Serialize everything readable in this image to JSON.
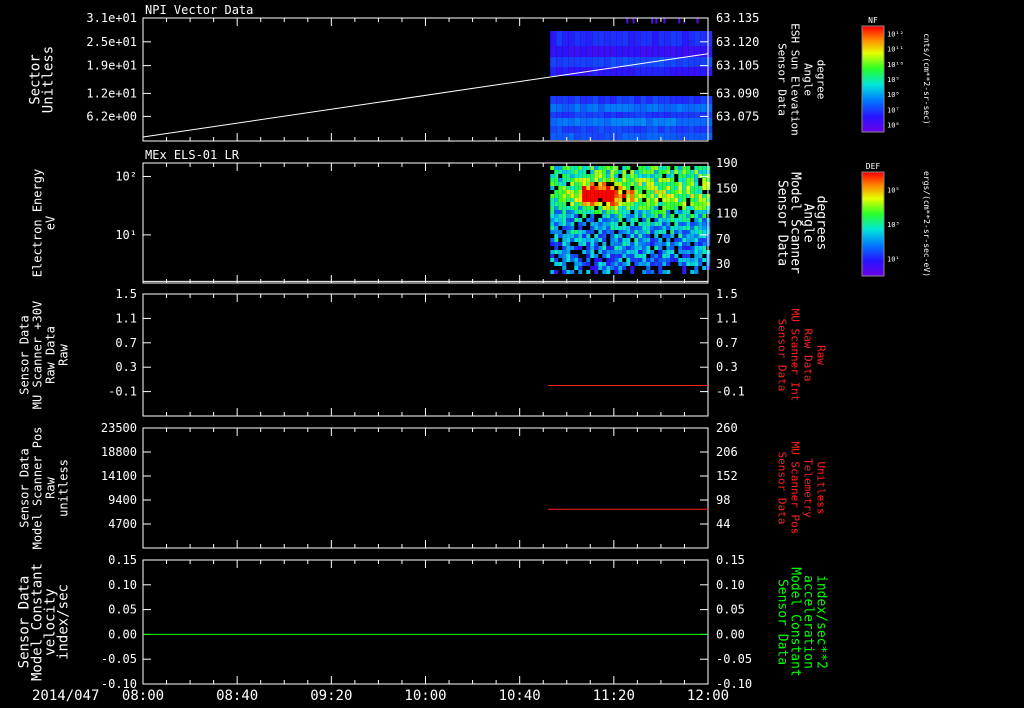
{
  "chart_data": {
    "type": "heatmap",
    "date_label": "2014/047",
    "x_ticks": [
      "08:00",
      "08:40",
      "09:20",
      "10:00",
      "10:40",
      "11:20",
      "12:00"
    ],
    "x_range": [
      "08:00",
      "12:00"
    ],
    "data_start": "10:53",
    "panels": [
      {
        "title": "NPI Vector Data",
        "left_label": [
          "Sector",
          "Unitless"
        ],
        "left_ticks": [
          "3.1e+01",
          "2.5e+01",
          "1.9e+01",
          "1.2e+01",
          "6.2e+00"
        ],
        "left_tick_values": [
          31,
          25,
          19,
          12,
          6.2
        ],
        "left_range": [
          0,
          31
        ],
        "right_label": [
          "Sensor Data",
          "ESH Sun Elevation",
          "Angle",
          "degree"
        ],
        "right_ticks": [
          "63.135",
          "63.120",
          "63.105",
          "63.090",
          "63.075"
        ],
        "line_color": "#ffffff",
        "line": {
          "x": [
            "08:00",
            "12:00"
          ],
          "y": [
            1.0,
            22.0
          ]
        },
        "colorbar": {
          "label": "NF",
          "unit": "cnts/(cm**2-sr-sec)",
          "ticks": [
            "10¹²",
            "10¹¹",
            "10¹⁰",
            "10⁹",
            "10⁸",
            "10⁷",
            "10⁶"
          ]
        }
      },
      {
        "title": "MEx ELS-01 LR",
        "left_label": [
          "Electron Energy",
          "eV"
        ],
        "left_ticks": [
          "10²",
          "10¹"
        ],
        "left_tick_values": [
          100,
          10
        ],
        "left_range": [
          1.5,
          170
        ],
        "right_label": [
          "Sensor Data",
          "Model Scanner",
          "Angle",
          "degrees"
        ],
        "right_ticks": [
          "190",
          "150",
          "110",
          "70",
          "30"
        ],
        "line_color": "#ffffff",
        "line": {
          "x": [
            "08:00",
            "12:00"
          ],
          "y": [
            1.6,
            1.6
          ]
        },
        "colorbar": {
          "label": "DEF",
          "unit": "ergs/(cm**2-sr-sec-eV)",
          "ticks": [
            "10⁵",
            "10³",
            "10¹"
          ]
        }
      },
      {
        "left_label": [
          "Sensor Data",
          "MU Scanner +30V",
          "Raw Data",
          "Raw"
        ],
        "left_ticks": [
          "1.5",
          "1.1",
          "0.7",
          "0.3",
          "-0.1"
        ],
        "left_tick_values": [
          1.5,
          1.1,
          0.7,
          0.3,
          -0.1
        ],
        "left_range": [
          -0.5,
          1.5
        ],
        "right_label": [
          "Sensor Data",
          "MU Scanner Int",
          "Raw Data",
          "Raw"
        ],
        "right_ticks": [
          "1.5",
          "1.1",
          "0.7",
          "0.3",
          "-0.1"
        ],
        "right_color": "#ff2020",
        "line_color": "#ff2020",
        "line": {
          "x": [
            "10:52",
            "12:00"
          ],
          "y": [
            0.0,
            0.0
          ]
        }
      },
      {
        "left_label": [
          "Sensor Data",
          "Model Scanner Pos",
          "Raw",
          "unitless"
        ],
        "left_ticks": [
          "23500",
          "18800",
          "14100",
          "9400",
          "4700"
        ],
        "left_tick_values": [
          23500,
          18800,
          14100,
          9400,
          4700
        ],
        "left_range": [
          0,
          23500
        ],
        "right_label": [
          "Sensor Data",
          "MU Scanner Pos",
          "Telemetry",
          "Unitless"
        ],
        "right_ticks": [
          "260",
          "206",
          "152",
          "98",
          "44"
        ],
        "right_color": "#ff2020",
        "line_color": "#ff2020",
        "line": {
          "x": [
            "10:52",
            "12:00"
          ],
          "y": [
            7600,
            7600
          ]
        }
      },
      {
        "left_label": [
          "Sensor Data",
          "Model Constant",
          "velocity",
          "index/sec"
        ],
        "left_ticks": [
          "0.15",
          "0.10",
          "0.05",
          "0.00",
          "-0.05",
          "-0.10"
        ],
        "left_tick_values": [
          0.15,
          0.1,
          0.05,
          0.0,
          -0.05,
          -0.1
        ],
        "left_range": [
          -0.1,
          0.15
        ],
        "right_label": [
          "Sensor Data",
          "Model Constant",
          "acceleration",
          "index/sec**2"
        ],
        "right_ticks": [
          "0.15",
          "0.10",
          "0.05",
          "0.00",
          "-0.05",
          "-0.10"
        ],
        "right_color": "#00ff00",
        "line_color": "#00ff00",
        "line": {
          "x": [
            "08:00",
            "12:00"
          ],
          "y": [
            0.0,
            0.0
          ]
        }
      }
    ]
  }
}
